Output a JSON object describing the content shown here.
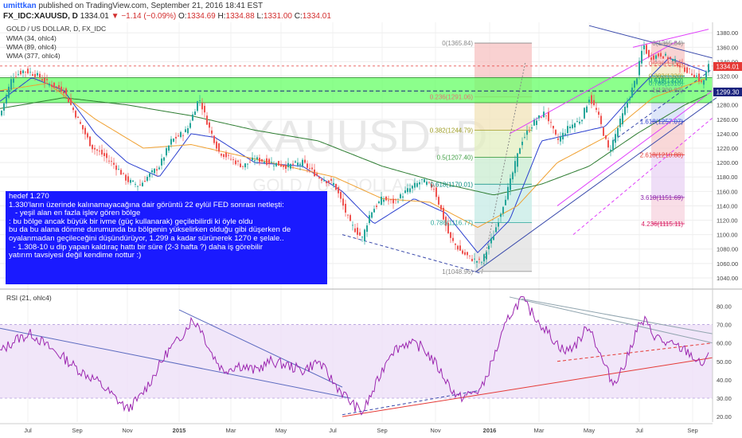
{
  "header": {
    "user": "umittkan",
    "published_text": "published on TradingView.com, September 21, 2016 18:41 EST",
    "symbol": "FX_IDC:XAUUSD, D",
    "last": "1334.01",
    "change": "−1.14 (−0.09%)",
    "open_label": "O:",
    "open": "1334.69",
    "high_label": "H:",
    "high": "1334.88",
    "low_label": "L:",
    "low": "1331.00",
    "close_label": "C:",
    "close": "1334.01"
  },
  "legend": {
    "title": "GOLD / US DOLLAR, D, FX_IDC",
    "items": [
      "WMA (34, ohlc4)",
      "WMA (89, ohlc4)",
      "WMA (377, ohlc4)"
    ]
  },
  "watermark": {
    "symbol": "XAUUSD, D",
    "name": "GOLD / US DOLLAR"
  },
  "note": {
    "lines": [
      "hedef 1.270",
      "",
      "1.330'ların üzerinde kalınamayacağına dair görüntü 22 eylül FED sonrası netleşti:",
      "",
      "   - yeşil alan en fazla işlev gören bölge",
      ": bu bölge ancak büyük bir ivme (güç kullanarak) geçilebilirdi ki öyle oldu",
      "bu da bu alana dönme durumunda bu bölgenin yükselirken olduğu gibi düşerken de",
      "oyalanmadan geçileceğini düşündürüyor, 1.299 a kadar sürünerek 1270 e şelale..",
      "  - 1.308-10 u dip yapan kaldıraç hattı bir süre (2-3 hafta ?) daha iş görebilir",
      "",
      "yatırım tavsiyesi değil kendime nottur :)"
    ]
  },
  "price_labels": {
    "last": "1334.01",
    "level": "1299.30"
  },
  "colors": {
    "candle_up": "#26a69a",
    "candle_down": "#ef5350",
    "green_zone": "#66ff66",
    "wma34": "#2a3fcf",
    "wma89": "#f0a030",
    "wma377": "#2e7d32",
    "rsi": "#9c27b0",
    "note_bg": "#1a1aff"
  },
  "chart_data": [
    {
      "type": "candlestick",
      "title": "GOLD / US DOLLAR, D, FX_IDC",
      "y_ticks": [
        1040,
        1060,
        1080,
        1100,
        1120,
        1140,
        1160,
        1180,
        1200,
        1220,
        1240,
        1260,
        1280,
        1300,
        1320,
        1340,
        1360,
        1380
      ],
      "ylim": [
        1030,
        1388
      ],
      "x_ticks": [
        "Jul",
        "Sep",
        "Nov",
        "2015",
        "Mar",
        "May",
        "Jul",
        "Sep",
        "Nov",
        "2016",
        "Mar",
        "May",
        "Jul",
        "Sep"
      ],
      "price_path": [
        [
          0,
          1265
        ],
        [
          15,
          1318
        ],
        [
          30,
          1328
        ],
        [
          45,
          1322
        ],
        [
          60,
          1310
        ],
        [
          80,
          1300
        ],
        [
          100,
          1255
        ],
        [
          115,
          1222
        ],
        [
          130,
          1210
        ],
        [
          145,
          1195
        ],
        [
          160,
          1175
        ],
        [
          175,
          1168
        ],
        [
          185,
          1180
        ],
        [
          200,
          1195
        ],
        [
          215,
          1230
        ],
        [
          235,
          1245
        ],
        [
          250,
          1290
        ],
        [
          262,
          1250
        ],
        [
          275,
          1215
        ],
        [
          290,
          1205
        ],
        [
          305,
          1195
        ],
        [
          320,
          1205
        ],
        [
          340,
          1200
        ],
        [
          360,
          1195
        ],
        [
          380,
          1200
        ],
        [
          400,
          1180
        ],
        [
          420,
          1170
        ],
        [
          440,
          1115
        ],
        [
          455,
          1095
        ],
        [
          465,
          1130
        ],
        [
          480,
          1150
        ],
        [
          495,
          1145
        ],
        [
          510,
          1160
        ],
        [
          530,
          1175
        ],
        [
          545,
          1165
        ],
        [
          555,
          1130
        ],
        [
          565,
          1095
        ],
        [
          580,
          1075
        ],
        [
          595,
          1065
        ],
        [
          605,
          1062
        ],
        [
          620,
          1100
        ],
        [
          640,
          1170
        ],
        [
          655,
          1230
        ],
        [
          670,
          1255
        ],
        [
          685,
          1270
        ],
        [
          700,
          1230
        ],
        [
          715,
          1250
        ],
        [
          730,
          1260
        ],
        [
          740,
          1290
        ],
        [
          750,
          1270
        ],
        [
          765,
          1215
        ],
        [
          775,
          1245
        ],
        [
          790,
          1290
        ],
        [
          800,
          1320
        ],
        [
          808,
          1365
        ],
        [
          815,
          1345
        ],
        [
          830,
          1350
        ],
        [
          845,
          1342
        ],
        [
          860,
          1330
        ],
        [
          875,
          1320
        ],
        [
          882,
          1308
        ],
        [
          890,
          1334
        ]
      ],
      "series": [
        {
          "name": "WMA (34, ohlc4)",
          "values": [
            [
              0,
              1285
            ],
            [
              40,
              1318
            ],
            [
              80,
              1300
            ],
            [
              120,
              1240
            ],
            [
              160,
              1200
            ],
            [
              200,
              1180
            ],
            [
              240,
              1240
            ],
            [
              270,
              1235
            ],
            [
              320,
              1200
            ],
            [
              380,
              1195
            ],
            [
              430,
              1160
            ],
            [
              470,
              1115
            ],
            [
              520,
              1150
            ],
            [
              560,
              1130
            ],
            [
              600,
              1075
            ],
            [
              640,
              1120
            ],
            [
              680,
              1230
            ],
            [
              720,
              1240
            ],
            [
              760,
              1250
            ],
            [
              800,
              1300
            ],
            [
              840,
              1345
            ],
            [
              890,
              1325
            ]
          ]
        },
        {
          "name": "WMA (89, ohlc4)",
          "values": [
            [
              0,
              1300
            ],
            [
              60,
              1310
            ],
            [
              120,
              1260
            ],
            [
              180,
              1220
            ],
            [
              240,
              1225
            ],
            [
              300,
              1210
            ],
            [
              360,
              1195
            ],
            [
              420,
              1180
            ],
            [
              480,
              1150
            ],
            [
              540,
              1145
            ],
            [
              600,
              1110
            ],
            [
              650,
              1140
            ],
            [
              700,
              1200
            ],
            [
              760,
              1235
            ],
            [
              820,
              1290
            ],
            [
              890,
              1318
            ]
          ]
        },
        {
          "name": "WMA (377, ohlc4)",
          "values": [
            [
              0,
              1275
            ],
            [
              80,
              1290
            ],
            [
              160,
              1280
            ],
            [
              240,
              1265
            ],
            [
              320,
              1245
            ],
            [
              400,
              1230
            ],
            [
              480,
              1195
            ],
            [
              560,
              1170
            ],
            [
              620,
              1155
            ],
            [
              680,
              1170
            ],
            [
              740,
              1195
            ],
            [
              800,
              1240
            ],
            [
              860,
              1280
            ],
            [
              890,
              1295
            ]
          ]
        }
      ],
      "fib_left": [
        {
          "label": "0(1365.84)",
          "value": 1365.84,
          "color": "#888888"
        },
        {
          "label": "0.236(1291.06)",
          "value": 1291.06,
          "color": "#e57373"
        },
        {
          "label": "0.382(1244.79)",
          "value": 1244.79,
          "color": "#9e9d24"
        },
        {
          "label": "0.5(1207.40)",
          "value": 1207.4,
          "color": "#43a047"
        },
        {
          "label": "0.618(1170.01)",
          "value": 1170.01,
          "color": "#00897b"
        },
        {
          "label": "0.786(1116.77)",
          "value": 1116.77,
          "color": "#26a69a"
        },
        {
          "label": "1(1048.96)",
          "value": 1048.96,
          "color": "#888888"
        }
      ],
      "fib_right": [
        {
          "label": "0(1365.84)",
          "value": 1365.84,
          "color": "#888888"
        },
        {
          "label": "0.236(1338)",
          "value": 1338,
          "color": "#e57373"
        },
        {
          "label": "0.382(1320)",
          "value": 1320,
          "color": "#9e9d24"
        },
        {
          "label": "0.618(1320)",
          "value": 1320,
          "color": "#00897b"
        },
        {
          "label": "0.786(1310)",
          "value": 1310,
          "color": "#26a69a"
        },
        {
          "label": "1(1300.83)",
          "value": 1300.83,
          "color": "#888888"
        },
        {
          "label": "1.618(1257.07)",
          "value": 1257.07,
          "color": "#2a3fcf"
        },
        {
          "label": "2.618(1210.88)",
          "value": 1210.88,
          "color": "#e53935"
        },
        {
          "label": "3.618(1151.69)",
          "value": 1151.69,
          "color": "#8e24aa"
        },
        {
          "label": "4.236(1115.11)",
          "value": 1115.11,
          "color": "#d81b60"
        }
      ],
      "green_zone": [
        1283,
        1318
      ],
      "level_1299": 1299.3
    },
    {
      "type": "line",
      "title": "RSI (21, ohlc4)",
      "y_ticks": [
        20,
        30,
        40,
        50,
        60,
        70,
        80
      ],
      "ylim": [
        17,
        88
      ],
      "overbought": 70,
      "oversold": 30,
      "values": [
        [
          0,
          55
        ],
        [
          20,
          62
        ],
        [
          40,
          65
        ],
        [
          60,
          58
        ],
        [
          80,
          52
        ],
        [
          100,
          45
        ],
        [
          120,
          40
        ],
        [
          140,
          32
        ],
        [
          160,
          24
        ],
        [
          175,
          30
        ],
        [
          190,
          40
        ],
        [
          210,
          55
        ],
        [
          225,
          62
        ],
        [
          240,
          72
        ],
        [
          250,
          70
        ],
        [
          265,
          55
        ],
        [
          280,
          45
        ],
        [
          300,
          48
        ],
        [
          320,
          45
        ],
        [
          340,
          50
        ],
        [
          360,
          48
        ],
        [
          380,
          45
        ],
        [
          400,
          50
        ],
        [
          420,
          38
        ],
        [
          440,
          28
        ],
        [
          455,
          22
        ],
        [
          470,
          35
        ],
        [
          490,
          55
        ],
        [
          510,
          60
        ],
        [
          530,
          58
        ],
        [
          545,
          50
        ],
        [
          560,
          40
        ],
        [
          575,
          30
        ],
        [
          590,
          32
        ],
        [
          605,
          35
        ],
        [
          620,
          52
        ],
        [
          640,
          75
        ],
        [
          655,
          84
        ],
        [
          665,
          78
        ],
        [
          680,
          70
        ],
        [
          695,
          62
        ],
        [
          710,
          55
        ],
        [
          725,
          60
        ],
        [
          740,
          70
        ],
        [
          755,
          52
        ],
        [
          770,
          38
        ],
        [
          785,
          48
        ],
        [
          800,
          68
        ],
        [
          810,
          72
        ],
        [
          820,
          65
        ],
        [
          835,
          60
        ],
        [
          850,
          58
        ],
        [
          865,
          55
        ],
        [
          880,
          48
        ],
        [
          890,
          52
        ]
      ]
    }
  ]
}
